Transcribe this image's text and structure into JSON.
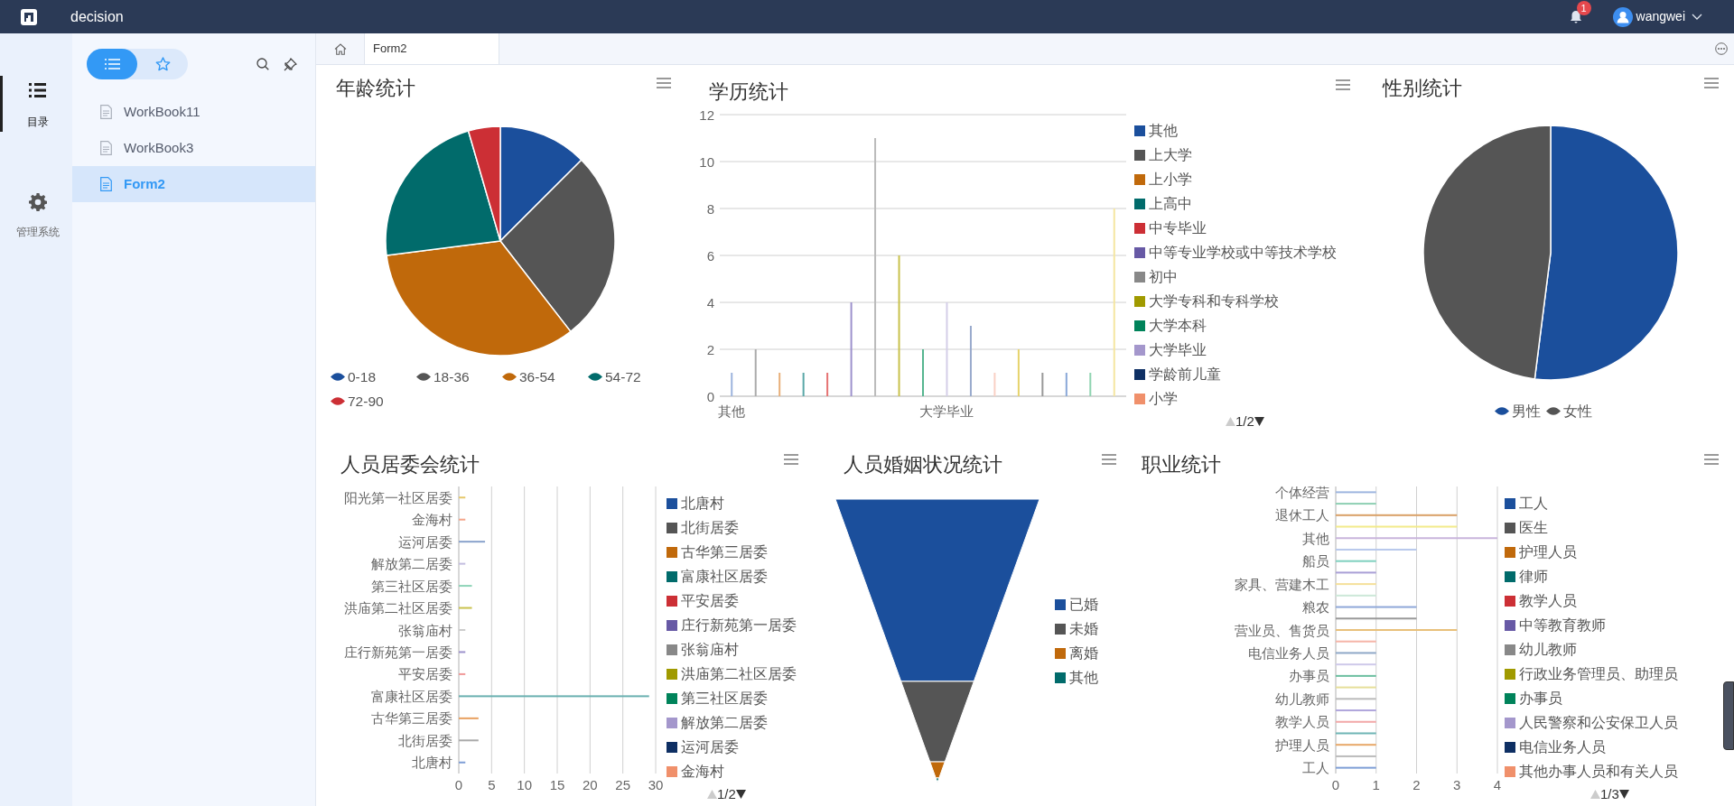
{
  "top_bar": {
    "app_name": "decision",
    "notification_count": "1",
    "user_name": "wangwei"
  },
  "nav": [
    {
      "label": "目录",
      "selected": true
    },
    {
      "label": "管理系统",
      "selected": false
    }
  ],
  "directory": {
    "view_modes": [
      {
        "selected": true
      },
      {
        "selected": false
      }
    ],
    "items": [
      {
        "label": "WorkBook11",
        "selected": false
      },
      {
        "label": "WorkBook3",
        "selected": false
      },
      {
        "label": "Form2",
        "selected": true
      }
    ]
  },
  "tabs": [
    {
      "label": "Form2",
      "selected": true
    }
  ],
  "age_chart": {
    "title": "年龄统计",
    "legend": [
      {
        "label": "0-18",
        "color": "#1b4f9c"
      },
      {
        "label": "18-36",
        "color": "#555555"
      },
      {
        "label": "36-54",
        "color": "#c0690b"
      },
      {
        "label": "54-72",
        "color": "#016b6b"
      },
      {
        "label": "72-90",
        "color": "#cc2f35"
      }
    ]
  },
  "education_chart": {
    "title": "学历统计",
    "chart_data": {
      "type": "bar",
      "grid": true,
      "ylim": [
        0,
        12
      ],
      "yticks": [
        0,
        2,
        4,
        6,
        8,
        10,
        12
      ],
      "categories": [
        "其他",
        null,
        null,
        null,
        null,
        null,
        null,
        null,
        null,
        "大学毕业",
        null,
        null,
        null,
        null,
        null,
        null,
        null
      ],
      "values": [
        1,
        2,
        1,
        1,
        1,
        4,
        11,
        6,
        2,
        4,
        3,
        1,
        2,
        1,
        1,
        1,
        8
      ],
      "colors": [
        "#9db4dd",
        "#aaaaaa",
        "#e8b07a",
        "#5aa8a8",
        "#e57373",
        "#9d92cc",
        "#bbbbbb",
        "#c9c24d",
        "#55b58f",
        "#d4cfe8",
        "#99aacc",
        "#f9d0c4",
        "#e6d36b",
        "#999999",
        "#8aa8d8",
        "#8fd4b0",
        "#f5e6a0"
      ]
    },
    "legend": [
      {
        "label": "其他",
        "color": "#1b4f9c"
      },
      {
        "label": "上大学",
        "color": "#555555"
      },
      {
        "label": "上小学",
        "color": "#c0690b"
      },
      {
        "label": "上高中",
        "color": "#016b6b"
      },
      {
        "label": "中专毕业",
        "color": "#cc2f35"
      },
      {
        "label": "中等专业学校或中等技术学校",
        "color": "#6759a5"
      },
      {
        "label": "初中",
        "color": "#888888"
      },
      {
        "label": "大学专科和专科学校",
        "color": "#a09a00"
      },
      {
        "label": "大学本科",
        "color": "#00835a"
      },
      {
        "label": "大学毕业",
        "color": "#a497cc"
      },
      {
        "label": "学龄前儿童",
        "color": "#0e2f63"
      },
      {
        "label": "小学",
        "color": "#f0906b"
      }
    ],
    "page": "1/2"
  },
  "gender_chart": {
    "title": "性别统计",
    "legend": [
      {
        "label": "男性",
        "color": "#1b4f9c"
      },
      {
        "label": "女性",
        "color": "#555555"
      }
    ]
  },
  "committee_chart": {
    "title": "人员居委会统计",
    "chart_data": {
      "type": "bar",
      "orientation": "horizontal",
      "grid": true,
      "categories": [
        "阳光第一社区居委",
        "金海村",
        "运河居委",
        "解放第二居委",
        "第三社区居委",
        "洪庙第二社区居委",
        "张翁庙村",
        "庄行新苑第一居委",
        "平安居委",
        "富康社区居委",
        "古华第三居委",
        "北街居委",
        "北唐村"
      ],
      "values": [
        1,
        1,
        4,
        1,
        2,
        2,
        1,
        1,
        1,
        29,
        3,
        3,
        1
      ],
      "colors": [
        "#e6c86b",
        "#f4a58a",
        "#8aa3cc",
        "#c4bde0",
        "#8fd4b8",
        "#c9c24d",
        "#cccccc",
        "#9d92cc",
        "#f09a9a",
        "#6ab0b0",
        "#e8a060",
        "#aaaaaa",
        "#7f9fd6"
      ],
      "xlim": [
        0,
        30
      ],
      "xticks": [
        0,
        5,
        10,
        15,
        20,
        25,
        30
      ]
    },
    "legend": [
      {
        "label": "北唐村",
        "color": "#1b4f9c"
      },
      {
        "label": "北街居委",
        "color": "#555555"
      },
      {
        "label": "古华第三居委",
        "color": "#c0690b"
      },
      {
        "label": "富康社区居委",
        "color": "#016b6b"
      },
      {
        "label": "平安居委",
        "color": "#cc2f35"
      },
      {
        "label": "庄行新苑第一居委",
        "color": "#6759a5"
      },
      {
        "label": "张翁庙村",
        "color": "#888888"
      },
      {
        "label": "洪庙第二社区居委",
        "color": "#a09a00"
      },
      {
        "label": "第三社区居委",
        "color": "#00835a"
      },
      {
        "label": "解放第二居委",
        "color": "#a497cc"
      },
      {
        "label": "运河居委",
        "color": "#0e2f63"
      },
      {
        "label": "金海村",
        "color": "#f0906b"
      }
    ],
    "page": "1/2"
  },
  "marriage_chart": {
    "title": "人员婚姻状况统计",
    "legend": [
      {
        "label": "已婚",
        "color": "#1b4f9c"
      },
      {
        "label": "未婚",
        "color": "#555555"
      },
      {
        "label": "离婚",
        "color": "#c0690b"
      },
      {
        "label": "其他",
        "color": "#016b6b"
      }
    ]
  },
  "occupation_chart": {
    "title": "职业统计",
    "chart_data": {
      "type": "bar",
      "orientation": "horizontal",
      "grid": true,
      "categories": [
        "个体经营",
        null,
        "退休工人",
        null,
        "其他",
        null,
        "船员",
        null,
        "家具、营建木工",
        null,
        "粮农",
        null,
        "营业员、售货员",
        null,
        "电信业务人员",
        null,
        "办事员",
        null,
        "幼儿教师",
        null,
        "教学人员",
        null,
        "护理人员",
        null,
        "工人"
      ],
      "values": [
        1,
        1,
        3,
        3,
        4,
        2,
        1,
        1,
        1,
        1,
        2,
        2,
        3,
        1,
        1,
        1,
        1,
        1,
        1,
        1,
        1,
        1,
        1,
        1,
        1
      ],
      "colors": [
        "#9fb6e0",
        "#8fd0b4",
        "#d9a066",
        "#f2ea8a",
        "#c9b5dc",
        "#b8c9ec",
        "#7fd1bf",
        "#a99fd6",
        "#f5e09a",
        "#cde8d8",
        "#8fa8d8",
        "#999999",
        "#e8c07a",
        "#f5b5a8",
        "#8fa8c8",
        "#cfc9ea",
        "#6cbfa0",
        "#e6df9a",
        "#bbbbbb",
        "#b0a6dc",
        "#f2a8a8",
        "#6fb5b5",
        "#e8a868",
        "#bbbbbb",
        "#7f9fd6"
      ],
      "xlim": [
        0,
        4
      ],
      "xticks": [
        0,
        1,
        2,
        3,
        4
      ]
    },
    "legend": [
      {
        "label": "工人",
        "color": "#1b4f9c"
      },
      {
        "label": "医生",
        "color": "#555555"
      },
      {
        "label": "护理人员",
        "color": "#c0690b"
      },
      {
        "label": "律师",
        "color": "#016b6b"
      },
      {
        "label": "教学人员",
        "color": "#cc2f35"
      },
      {
        "label": "中等教育教师",
        "color": "#6759a5"
      },
      {
        "label": "幼儿教师",
        "color": "#888888"
      },
      {
        "label": "行政业务管理员、助理员",
        "color": "#a09a00"
      },
      {
        "label": "办事员",
        "color": "#00835a"
      },
      {
        "label": "人民警察和公安保卫人员",
        "color": "#a497cc"
      },
      {
        "label": "电信业务人员",
        "color": "#0e2f63"
      },
      {
        "label": "其他办事人员和有关人员",
        "color": "#f0906b"
      }
    ],
    "page": "1/3"
  }
}
